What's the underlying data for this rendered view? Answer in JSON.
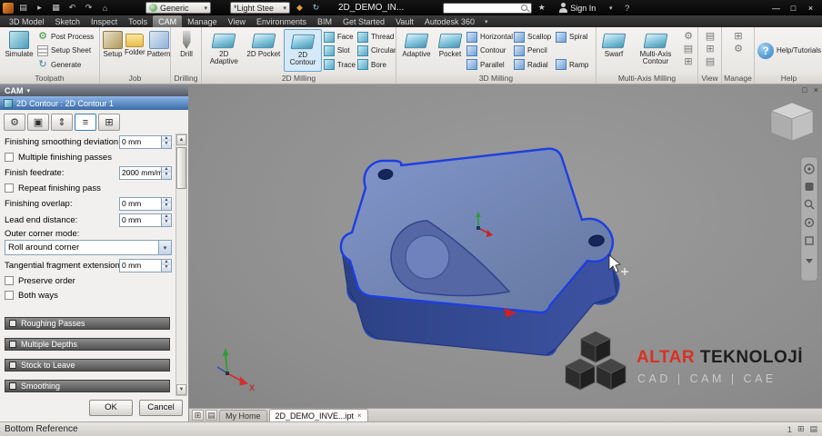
{
  "glyphs": {
    "dropdown": "▾",
    "spin_up": "▲",
    "spin_down": "▼",
    "close": "×",
    "minimize": "—",
    "maximize": "□",
    "gear": "⚙",
    "question": "?",
    "undo": "↶",
    "redo": "↷",
    "home": "⌂",
    "star": "★",
    "new_doc": "▤",
    "save": "▦",
    "open": "▸",
    "diamond": "◆",
    "refresh": "↻",
    "grid": "⊞",
    "list": "▤",
    "tab_tool": "⚙",
    "tab_geometry": "▣",
    "tab_heights": "⇕",
    "tab_passes": "≡",
    "tab_linking": "⊞"
  },
  "titlebar": {
    "generic": "Generic",
    "material": "*Light Stee",
    "doc_title": "2D_DEMO_IN...",
    "sign_in": "Sign In"
  },
  "tabs_bar": {
    "items": [
      "3D Model",
      "Sketch",
      "Inspect",
      "Tools",
      "CAM",
      "Manage",
      "View",
      "Environments",
      "BIM",
      "Get Started",
      "Vault",
      "Autodesk 360"
    ]
  },
  "ribbon": {
    "toolpath": {
      "label": "Toolpath",
      "simulate": "Simulate",
      "post_process": "Post Process",
      "setup_sheet": "Setup Sheet",
      "generate": "Generate"
    },
    "job": {
      "label": "Job",
      "setup": "Setup",
      "folder": "Folder",
      "pattern": "Pattern"
    },
    "drilling": {
      "label": "Drilling",
      "drill": "Drill"
    },
    "milling2d": {
      "label": "2D Milling",
      "adaptive": "2D Adaptive",
      "pocket": "2D Pocket",
      "contour": "2D Contour",
      "col1": [
        "Face",
        "Slot",
        "Trace"
      ],
      "col2": [
        "Thread",
        "Circular",
        "Bore"
      ]
    },
    "milling3d": {
      "label": "3D Milling",
      "adaptive": "Adaptive",
      "pocket": "Pocket",
      "col1": [
        "Horizontal",
        "Contour",
        "Parallel"
      ],
      "col2": [
        "Scallop",
        "Pencil",
        "Radial"
      ],
      "col3": [
        "Spiral",
        "Ramp"
      ]
    },
    "multiaxis": {
      "label": "Multi-Axis Milling",
      "swarf": "Swarf",
      "contour": "Multi-Axis Contour"
    },
    "view": {
      "label": "View"
    },
    "manage": {
      "label": "Manage"
    },
    "help": {
      "label": "Help",
      "item": "Help/Tutorials"
    }
  },
  "cam_panel": {
    "header": "CAM",
    "operation": "2D Contour : 2D Contour 1",
    "fields": [
      {
        "label": "Finishing smoothing deviation:",
        "value": "0 mm"
      },
      {
        "label": "Multiple finishing passes"
      },
      {
        "label": "Finish feedrate:",
        "value": "2000 mm/m"
      },
      {
        "label": "Repeat finishing pass"
      },
      {
        "label": "Finishing overlap:",
        "value": "0 mm"
      },
      {
        "label": "Lead end distance:",
        "value": "0 mm"
      },
      {
        "label": "Outer corner mode:",
        "value": "Roll around corner"
      },
      {
        "label": "Tangential fragment extension di...",
        "value": "0 mm"
      },
      {
        "label": "Preserve order"
      },
      {
        "label": "Both ways"
      }
    ],
    "sections": [
      "Roughing Passes",
      "Multiple Depths",
      "Stock to Leave",
      "Smoothing"
    ],
    "ok": "OK",
    "cancel": "Cancel"
  },
  "viewport": {
    "axis_x": "X"
  },
  "watermark": {
    "brand_red": "ALTAR",
    "brand_dark": " TEKNOLOJİ",
    "subtitle": "CAD | CAM | CAE"
  },
  "doc_tabs": {
    "home": "My Home",
    "document": "2D_DEMO_INVE...ipt"
  },
  "status_bar": {
    "left": "Bottom Reference",
    "badge": "1"
  }
}
